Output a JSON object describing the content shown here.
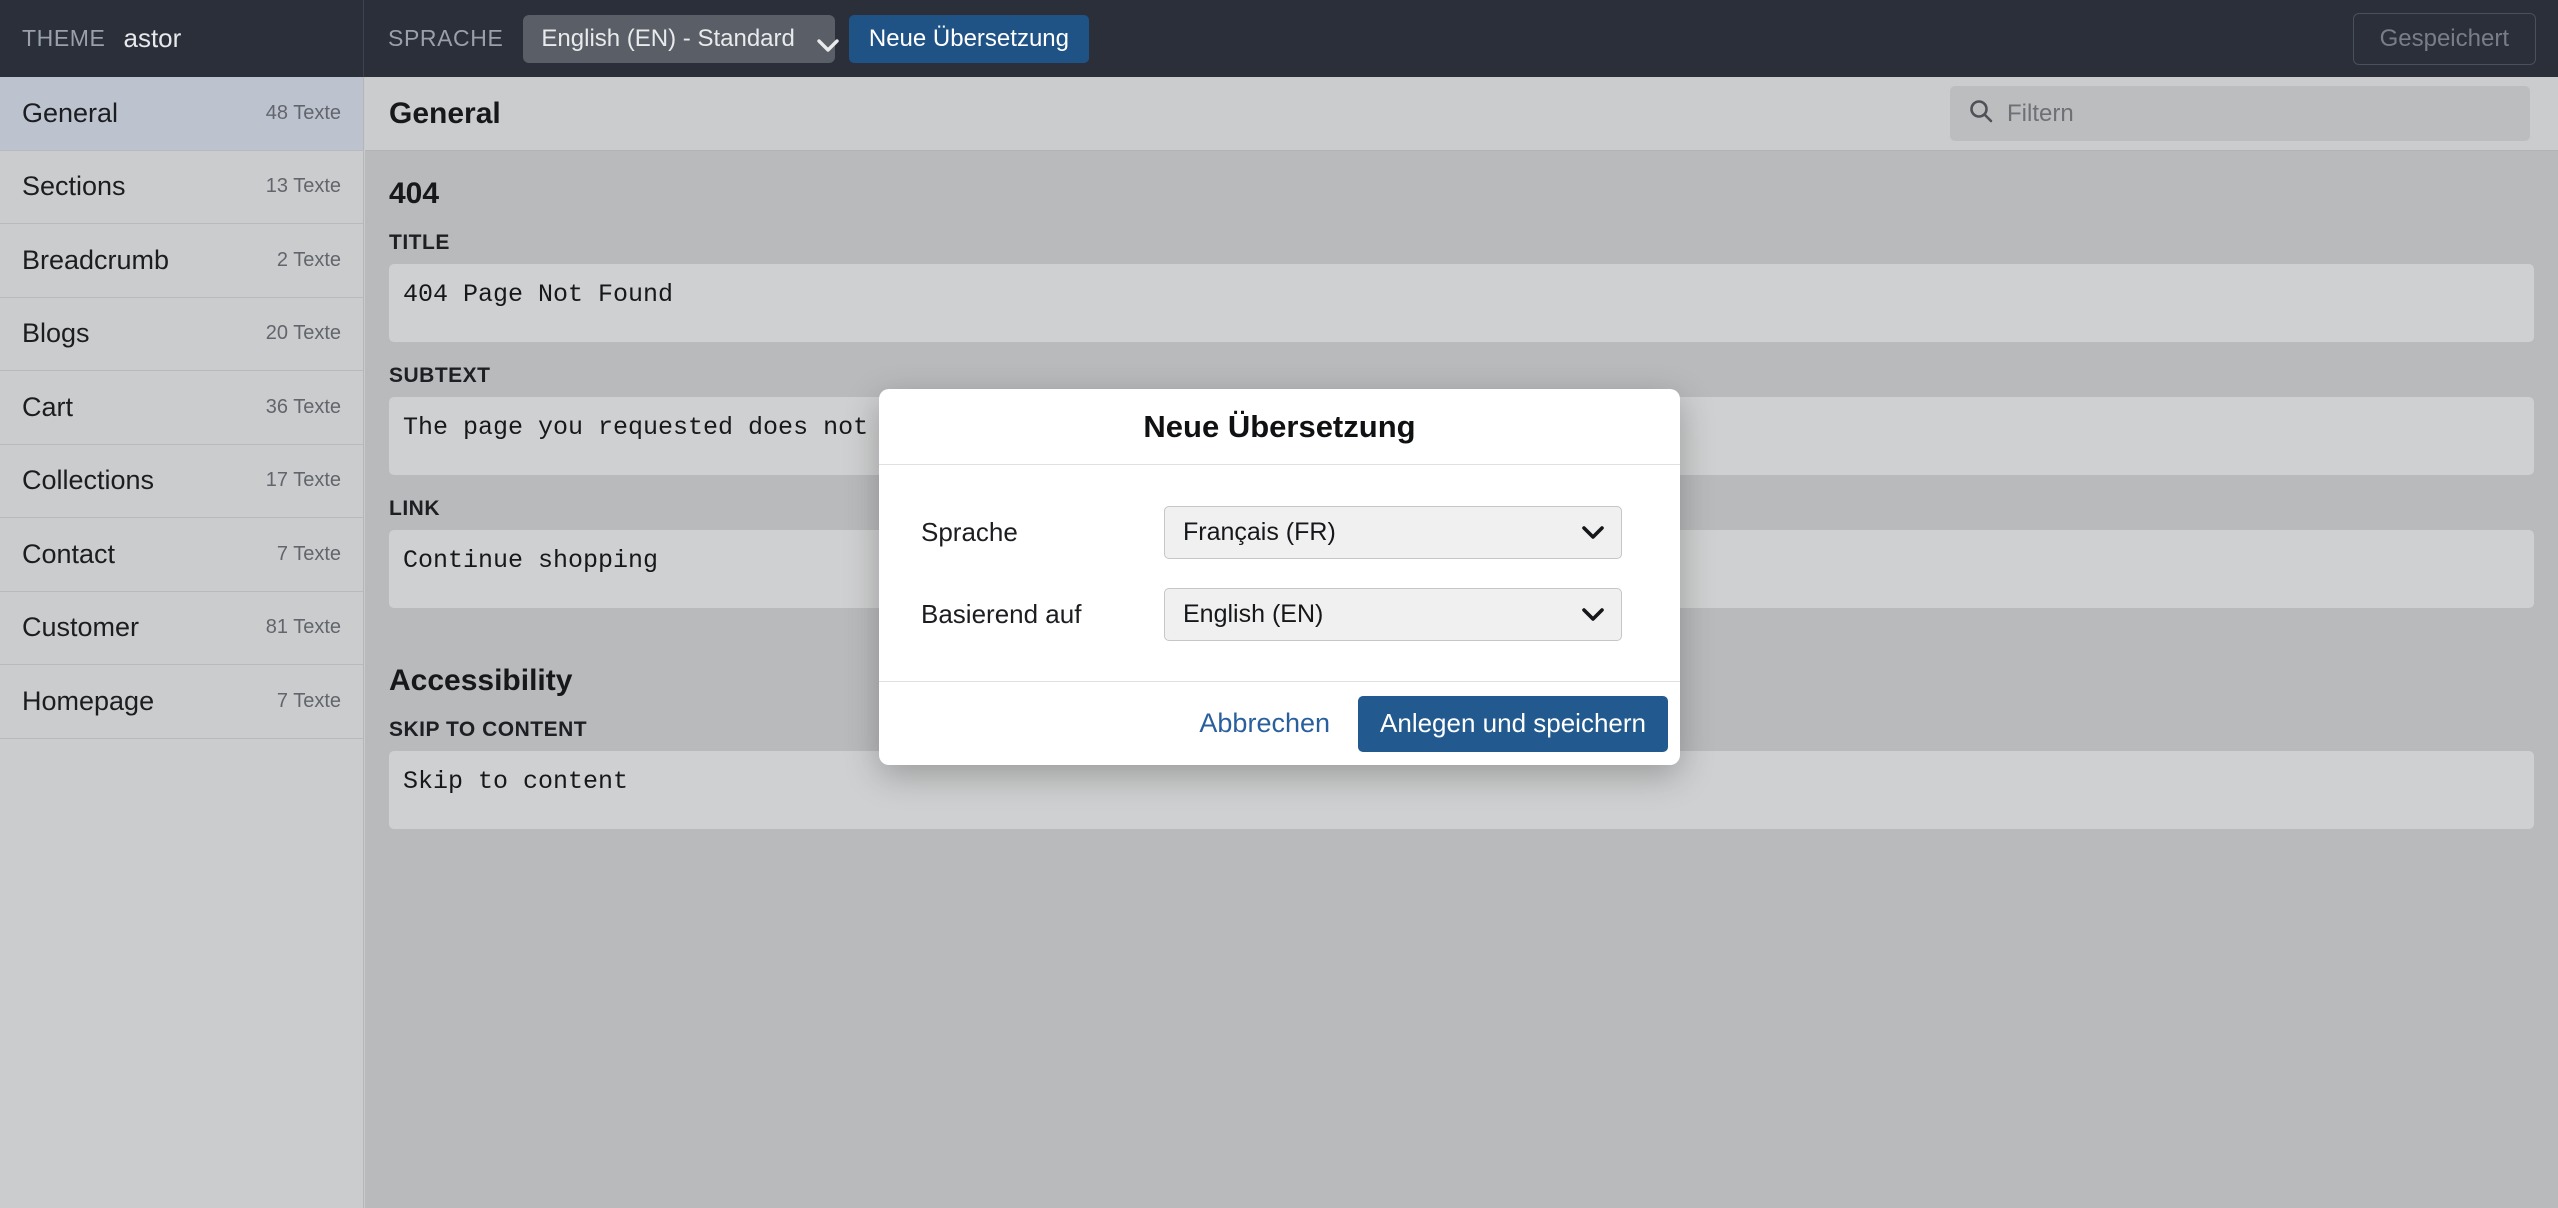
{
  "topbar": {
    "theme_label": "THEME",
    "theme_name": "astor",
    "sprache_label": "SPRACHE",
    "language_value": "English (EN) - Standard",
    "new_translation_label": "Neue Übersetzung",
    "saved_label": "Gespeichert",
    "accent_color": "#1f5285",
    "background_color": "#2a2f3a"
  },
  "sidebar": {
    "items": [
      {
        "label": "General",
        "count": "48 Texte",
        "active": true
      },
      {
        "label": "Sections",
        "count": "13 Texte",
        "active": false
      },
      {
        "label": "Breadcrumb",
        "count": "2 Texte",
        "active": false
      },
      {
        "label": "Blogs",
        "count": "20 Texte",
        "active": false
      },
      {
        "label": "Cart",
        "count": "36 Texte",
        "active": false
      },
      {
        "label": "Collections",
        "count": "17 Texte",
        "active": false
      },
      {
        "label": "Contact",
        "count": "7 Texte",
        "active": false
      },
      {
        "label": "Customer",
        "count": "81 Texte",
        "active": false
      },
      {
        "label": "Homepage",
        "count": "7 Texte",
        "active": false
      }
    ]
  },
  "main": {
    "title": "General",
    "filter_placeholder": "Filtern",
    "filter_value": "",
    "filter_icon": "search-icon",
    "sections": [
      {
        "title": "404",
        "fields": [
          {
            "label": "TITLE",
            "value": "404 Page Not Found"
          },
          {
            "label": "SUBTEXT",
            "value": "The page you requested does not exist."
          },
          {
            "label": "LINK",
            "value": "Continue shopping"
          }
        ]
      },
      {
        "title": "Accessibility",
        "fields": [
          {
            "label": "SKIP TO CONTENT",
            "value": "Skip to content"
          }
        ]
      }
    ]
  },
  "modal": {
    "title": "Neue Übersetzung",
    "rows": [
      {
        "label": "Sprache",
        "value": "Français (FR)"
      },
      {
        "label": "Basierend auf",
        "value": "English (EN)"
      }
    ],
    "cancel_label": "Abbrechen",
    "submit_label": "Anlegen und speichern",
    "submit_color": "#225a8f",
    "cancel_color": "#2a5f9e"
  }
}
